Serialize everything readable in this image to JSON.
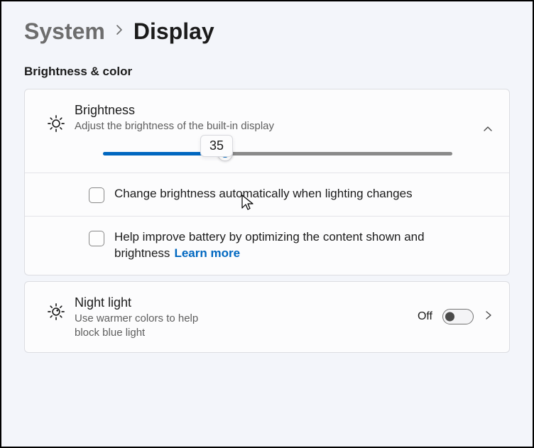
{
  "breadcrumb": {
    "parent": "System",
    "current": "Display"
  },
  "section": {
    "heading": "Brightness & color"
  },
  "brightness": {
    "title": "Brightness",
    "description": "Adjust the brightness of the built-in display",
    "value": 35,
    "tooltip": "35",
    "icon": "sun-icon"
  },
  "options": {
    "auto_brightness_label": "Change brightness automatically when lighting changes",
    "battery_optimize_label": "Help improve battery by optimizing the content shown and brightness",
    "learn_more": "Learn more"
  },
  "night_light": {
    "title": "Night light",
    "description": "Use warmer colors to help block blue light",
    "state": "Off",
    "enabled": false,
    "icon": "sun-accent-icon"
  }
}
